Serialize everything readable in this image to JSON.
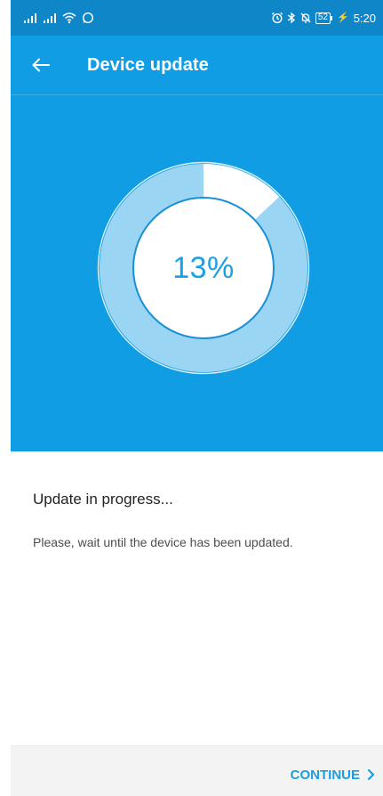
{
  "status_bar": {
    "time": "5:20",
    "battery": "52",
    "icons": [
      "signal-icon",
      "signal-icon",
      "wifi-icon",
      "whatsapp-icon",
      "alarm-icon",
      "bluetooth-icon",
      "mute-icon",
      "battery-icon",
      "charging-icon"
    ]
  },
  "app_bar": {
    "title": "Device update",
    "back_icon": "arrow-left-icon"
  },
  "progress": {
    "value": 13,
    "label": "13%"
  },
  "content": {
    "headline": "Update in progress...",
    "message": "Please, wait until the device has been updated."
  },
  "bottom_bar": {
    "continue_label": "CONTINUE",
    "continue_icon": "chevron-right-icon"
  },
  "colors": {
    "status_bar": "#0e86c7",
    "primary": "#119de3",
    "ring_light": "#9ad5f3",
    "ring_edge": "#d9f0fb",
    "white": "#ffffff",
    "bottom_bar": "#f3f3f3",
    "accent_text": "#1a9de1"
  }
}
